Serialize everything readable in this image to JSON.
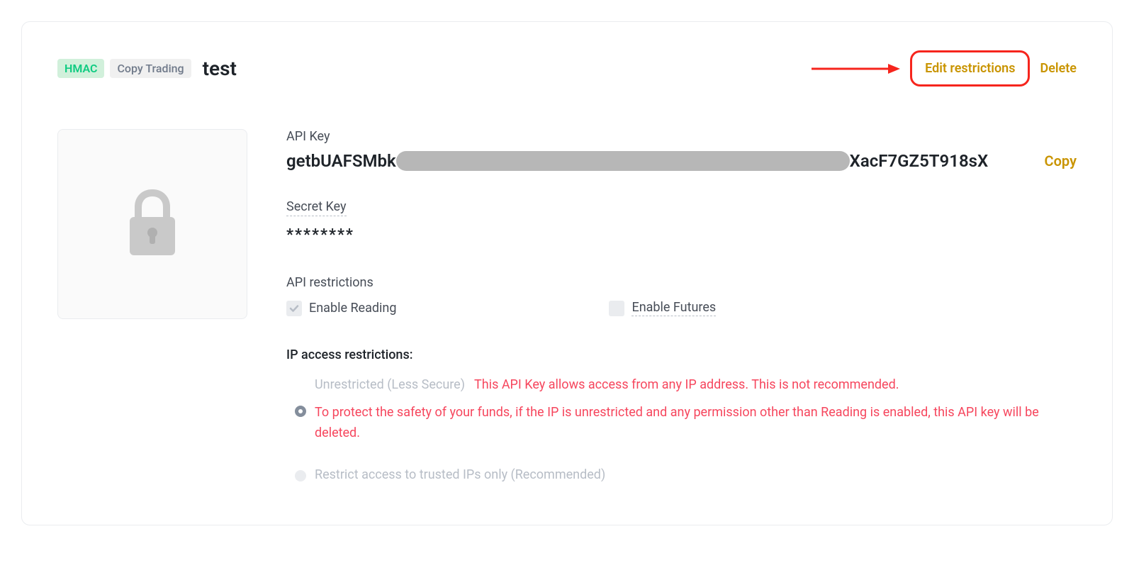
{
  "header": {
    "badge_hmac": "HMAC",
    "badge_copy": "Copy Trading",
    "title": "test",
    "edit_label": "Edit restrictions",
    "delete_label": "Delete"
  },
  "api_key": {
    "label": "API Key",
    "prefix": "getbUAFSMbk",
    "suffix": "XacF7GZ5T918sX",
    "copy_label": "Copy"
  },
  "secret_key": {
    "label": "Secret Key",
    "value": "********"
  },
  "restrictions": {
    "label": "API restrictions",
    "enable_reading": "Enable Reading",
    "enable_futures": "Enable Futures"
  },
  "ip": {
    "label": "IP access restrictions:",
    "option1_muted": "Unrestricted (Less Secure)",
    "option1_warn1": "This API Key allows access from any IP address. This is not recommended.",
    "option1_warn2": "To protect the safety of your funds, if the IP is unrestricted and any permission other than Reading is enabled, this API key will be deleted.",
    "option2": "Restrict access to trusted IPs only (Recommended)"
  },
  "colors": {
    "accent": "#c99400",
    "annotation": "#f6251d",
    "warn": "#f6465d"
  }
}
